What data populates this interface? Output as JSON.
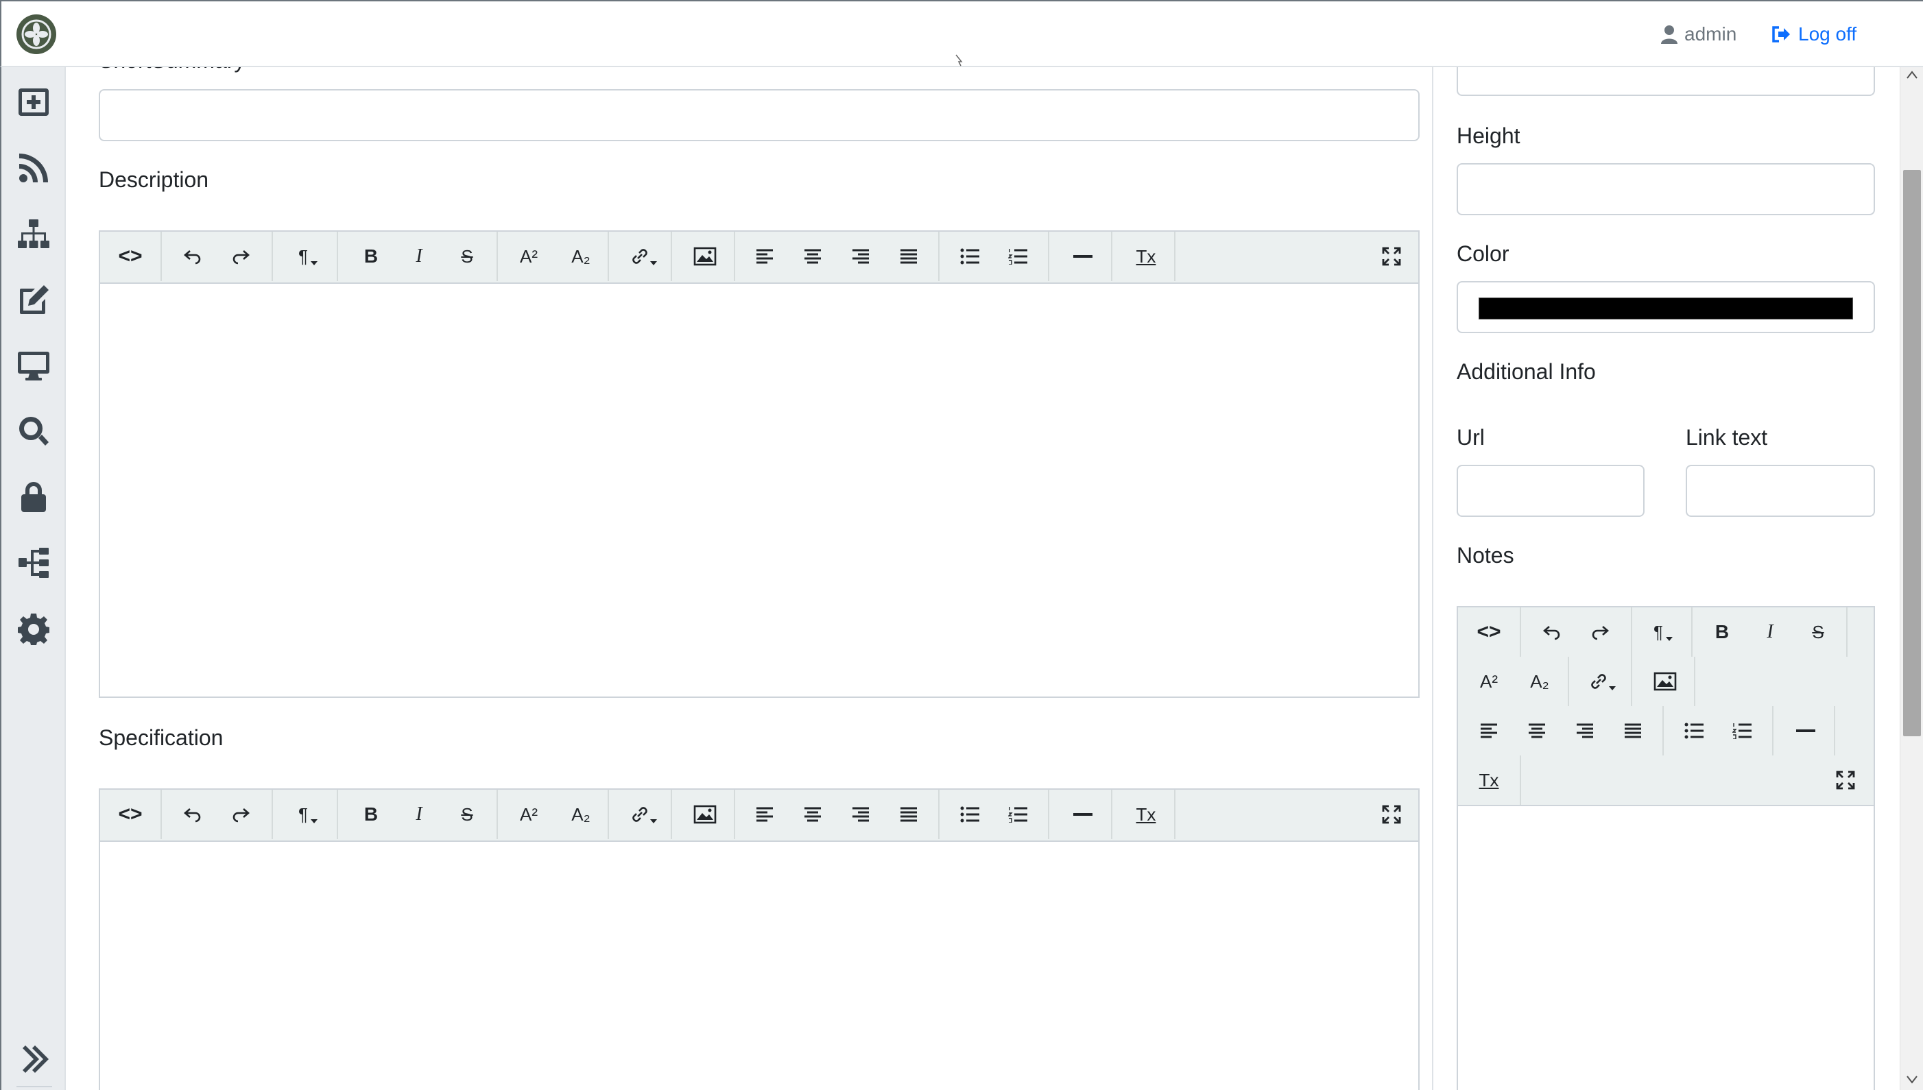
{
  "header": {
    "user_name": "admin",
    "logoff_label": "Log off"
  },
  "sidebar": {
    "items": [
      {
        "icon": "plus-square-icon"
      },
      {
        "icon": "rss-icon"
      },
      {
        "icon": "sitemap-icon"
      },
      {
        "icon": "edit-icon"
      },
      {
        "icon": "desktop-icon"
      },
      {
        "icon": "search-icon"
      },
      {
        "icon": "lock-icon"
      },
      {
        "icon": "tree-icon"
      },
      {
        "icon": "gear-icon"
      }
    ],
    "expand_icon": "double-chevron-right-icon"
  },
  "main": {
    "short_summary_label": "ShortSummary",
    "short_summary_value": "",
    "description_label": "Description",
    "specification_label": "Specification"
  },
  "right": {
    "height_label": "Height",
    "height_value": "",
    "color_label": "Color",
    "color_value": "#000000",
    "additional_info_label": "Additional Info",
    "url_label": "Url",
    "url_value": "",
    "link_text_label": "Link text",
    "link_text_value": "",
    "notes_label": "Notes"
  },
  "editor_toolbar": {
    "code": "<>",
    "paragraph": "¶",
    "bold": "B",
    "italic": "I",
    "strike": "S",
    "superscript": "A²",
    "subscript": "A₂",
    "clear_format": "Tx"
  },
  "colors": {
    "accent": "#0d6efd",
    "sidebar_bg": "#e9ecef",
    "toolbar_bg": "#ebf0f0",
    "logo": "#4a5a45"
  }
}
